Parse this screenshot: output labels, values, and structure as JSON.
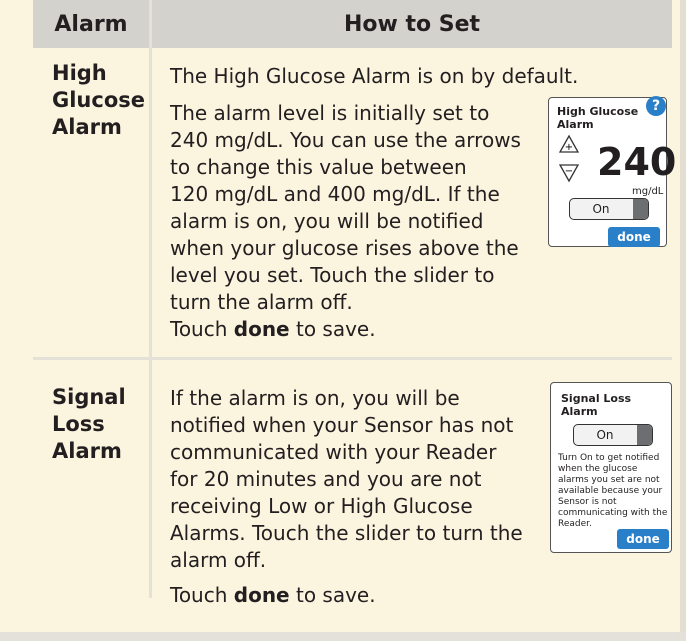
{
  "table": {
    "header_alarm": "Alarm",
    "header_how": "How to Set"
  },
  "high": {
    "name_l1": "High",
    "name_l2": "Glucose",
    "name_l3": "Alarm",
    "p1": "The High Glucose Alarm is on by default.",
    "p2_lines": [
      "The alarm level is initially set to",
      "240 mg/dL. You can use the arrows",
      "to change this value between",
      "120 mg/dL and 400 mg/dL. If the",
      "alarm is on, you will be notified",
      "when your glucose rises above the",
      "level you set. Touch the slider to",
      "turn the alarm off."
    ],
    "p3_pre": "Touch ",
    "p3_bold": "done",
    "p3_post": " to save.",
    "screen": {
      "title": "High Glucose Alarm",
      "help": "?",
      "value": "240",
      "unit": "mg/dL",
      "toggle": "On",
      "done": "done"
    }
  },
  "signal": {
    "name_l1": "Signal",
    "name_l2": "Loss",
    "name_l3": "Alarm",
    "p1_lines": [
      "If the alarm is on, you will be",
      "notified when your Sensor has not",
      "communicated with your Reader",
      "for 20 minutes and you are not",
      "receiving Low or High Glucose",
      "Alarms. Touch the slider to turn the",
      "alarm off."
    ],
    "p2_pre": "Touch ",
    "p2_bold": "done",
    "p2_post": " to save.",
    "screen": {
      "title": "Signal Loss Alarm",
      "toggle": "On",
      "note": "Turn On to get notified when the glucose alarms you set are not available because your Sensor is not communicating with the Reader.",
      "done": "done"
    }
  }
}
